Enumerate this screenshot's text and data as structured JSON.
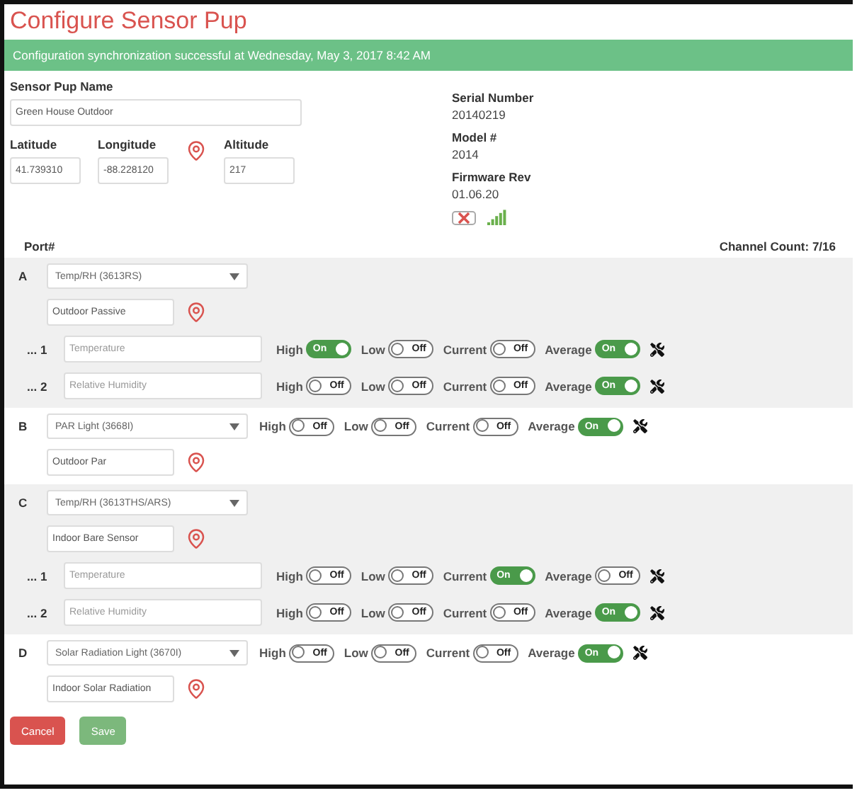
{
  "title": "Configure Sensor Pup",
  "banner": "Configuration synchronization successful at Wednesday, May 3, 2017 8:42 AM",
  "name_field": {
    "label": "Sensor Pup Name",
    "value": "Green House Outdoor"
  },
  "coords": [
    {
      "label": "Latitude",
      "value": "41.739310"
    },
    {
      "label": "Longitude",
      "value": "-88.228120"
    },
    {
      "label": "Altitude",
      "value": "217"
    }
  ],
  "info": [
    {
      "label": "Serial Number",
      "value": "20140219"
    },
    {
      "label": "Model #",
      "value": "2014"
    },
    {
      "label": "Firmware Rev",
      "value": "01.06.20"
    }
  ],
  "port_header": "Port#",
  "channel_count": "Channel Count: 7/16",
  "ports": [
    {
      "letter": "A",
      "kind": "multi",
      "sensor": "Temp/RH (3613RS)",
      "location": "Outdoor Passive",
      "channels": [
        {
          "number": "... 1",
          "placeholder": "Temperature",
          "toggles": [
            {
              "label": "High",
              "on": true,
              "text": "On"
            },
            {
              "label": "Low",
              "on": false,
              "text": "Off"
            },
            {
              "label": "Current",
              "on": false,
              "text": "Off"
            },
            {
              "label": "Average",
              "on": true,
              "text": "On"
            }
          ]
        },
        {
          "number": "... 2",
          "placeholder": "Relative Humidity",
          "toggles": [
            {
              "label": "High",
              "on": false,
              "text": "Off"
            },
            {
              "label": "Low",
              "on": false,
              "text": "Off"
            },
            {
              "label": "Current",
              "on": false,
              "text": "Off"
            },
            {
              "label": "Average",
              "on": true,
              "text": "On"
            }
          ]
        }
      ]
    },
    {
      "letter": "B",
      "kind": "single",
      "sensor": "PAR Light (3668I)",
      "location": "Outdoor Par",
      "toggles": [
        {
          "label": "High",
          "on": false,
          "text": "Off"
        },
        {
          "label": "Low",
          "on": false,
          "text": "Off"
        },
        {
          "label": "Current",
          "on": false,
          "text": "Off"
        },
        {
          "label": "Average",
          "on": true,
          "text": "On"
        }
      ]
    },
    {
      "letter": "C",
      "kind": "multi",
      "sensor": "Temp/RH (3613THS/ARS)",
      "location": "Indoor Bare Sensor",
      "channels": [
        {
          "number": "... 1",
          "placeholder": "Temperature",
          "toggles": [
            {
              "label": "High",
              "on": false,
              "text": "Off"
            },
            {
              "label": "Low",
              "on": false,
              "text": "Off"
            },
            {
              "label": "Current",
              "on": true,
              "text": "On"
            },
            {
              "label": "Average",
              "on": false,
              "text": "Off"
            }
          ]
        },
        {
          "number": "... 2",
          "placeholder": "Relative Humidity",
          "toggles": [
            {
              "label": "High",
              "on": false,
              "text": "Off"
            },
            {
              "label": "Low",
              "on": false,
              "text": "Off"
            },
            {
              "label": "Current",
              "on": false,
              "text": "Off"
            },
            {
              "label": "Average",
              "on": true,
              "text": "On"
            }
          ]
        }
      ]
    },
    {
      "letter": "D",
      "kind": "single",
      "sensor": "Solar Radiation Light (3670I)",
      "location": "Indoor Solar Radiation",
      "toggles": [
        {
          "label": "High",
          "on": false,
          "text": "Off"
        },
        {
          "label": "Low",
          "on": false,
          "text": "Off"
        },
        {
          "label": "Current",
          "on": false,
          "text": "Off"
        },
        {
          "label": "Average",
          "on": true,
          "text": "On"
        }
      ]
    }
  ],
  "buttons": [
    {
      "label": "Cancel",
      "kind": "danger"
    },
    {
      "label": "Save",
      "kind": "success"
    }
  ]
}
